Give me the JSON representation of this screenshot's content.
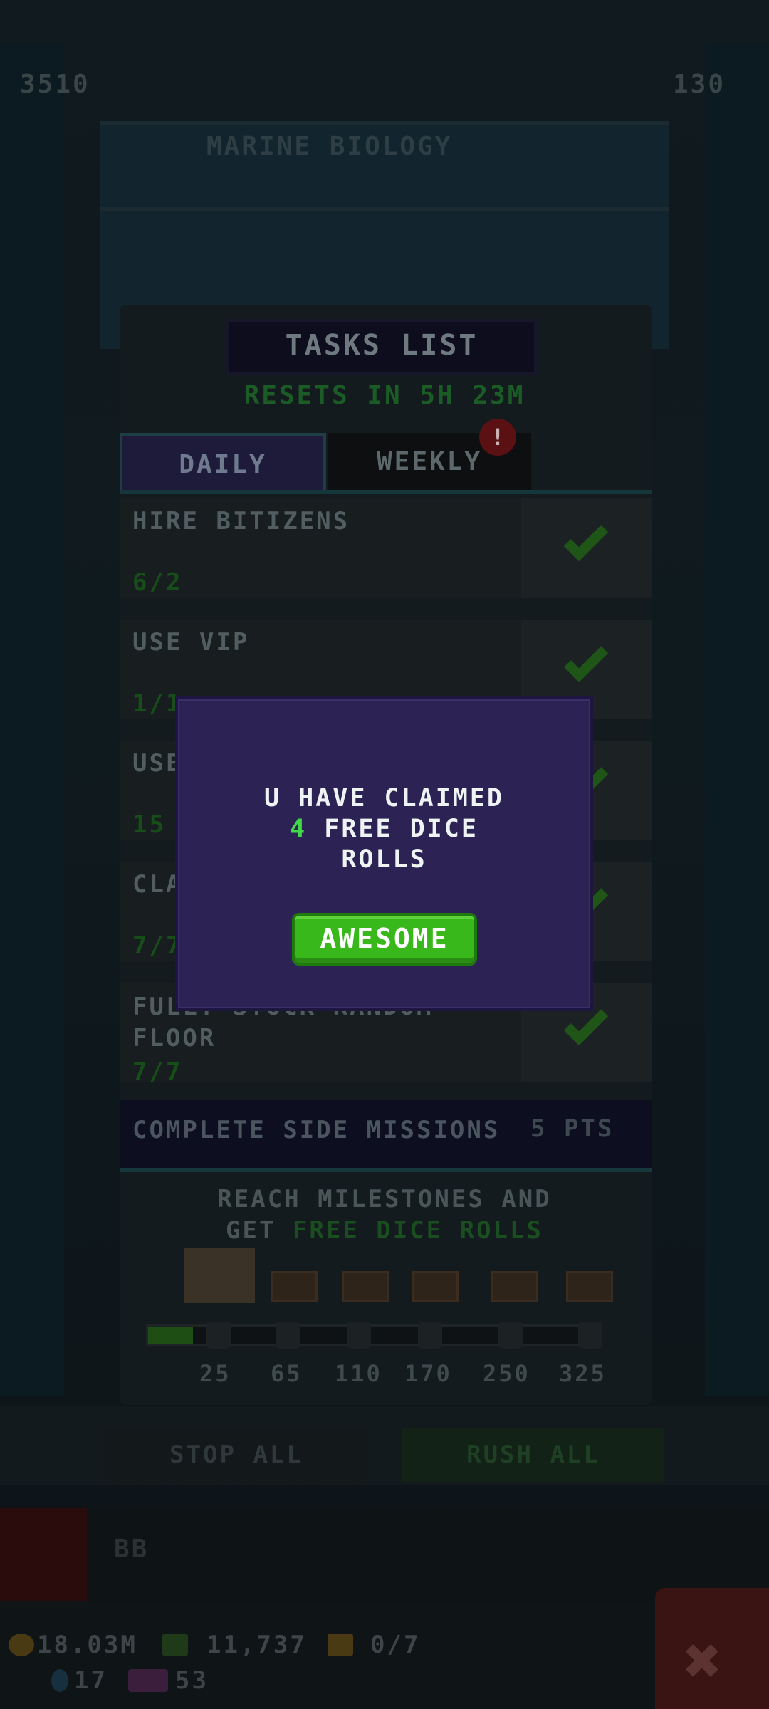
{
  "hud": {
    "left_value": "3510",
    "right_value": "130",
    "floor_name": "MARINE BIOLOGY"
  },
  "tasks": {
    "title": "TASKS LIST",
    "resets": "RESETS IN 5H 23M",
    "tabs": [
      {
        "label": "DAILY"
      },
      {
        "label": "WEEKLY",
        "alert": "!"
      }
    ],
    "rows": [
      {
        "name": "HIRE BITIZENS",
        "progress": "6/2"
      },
      {
        "name": "USE VIP",
        "progress": "1/1"
      },
      {
        "name": "USE",
        "progress": "15"
      },
      {
        "name": "CLA",
        "progress": "7/7"
      },
      {
        "name": "FULLY STOCK RANDOM FLOOR",
        "progress": "7/7"
      }
    ],
    "side_missions": {
      "label": "COMPLETE SIDE MISSIONS",
      "points": "5 PTS"
    },
    "milestone": {
      "line1": "REACH MILESTONES AND",
      "line2_prefix": "GET",
      "line2_highlight": "FREE DICE ROLLS"
    },
    "milestone_labels": [
      "25",
      "65",
      "110",
      "170",
      "250",
      "325"
    ],
    "milestone_progress": 0.1
  },
  "bottom": {
    "stop_all": "STOP ALL",
    "rush_all": "RUSH ALL",
    "elevator_label": "BB"
  },
  "status": {
    "coins": "18.03M",
    "bux": "11,737",
    "vip": "0/7",
    "gems": "17",
    "tickets": "53"
  },
  "dialog": {
    "line1": "U HAVE CLAIMED",
    "count": "4",
    "line2_rest": "FREE DICE",
    "line3": "ROLLS",
    "button": "AWESOME"
  },
  "colors": {
    "dialog_bg": "#2c2254",
    "button_green": "#39b81b",
    "highlight_green": "#41d84a"
  }
}
